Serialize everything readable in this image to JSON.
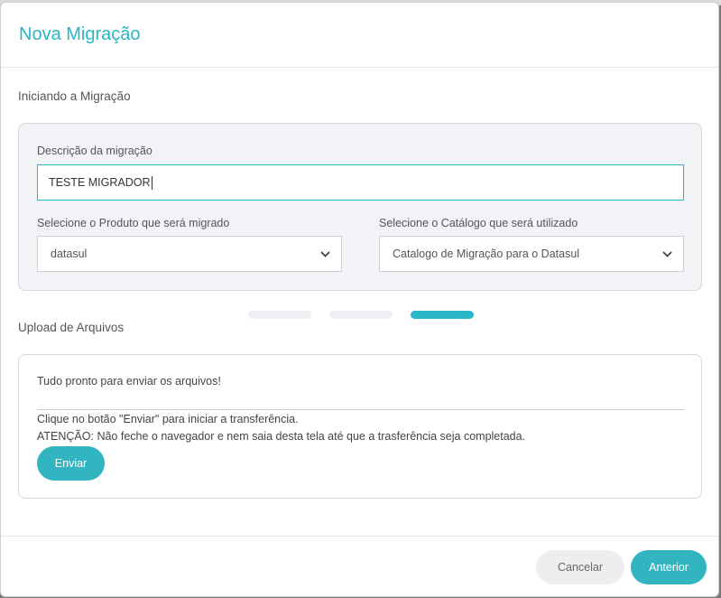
{
  "modal": {
    "title": "Nova Migração"
  },
  "start_section": {
    "label": "Iniciando a Migração",
    "description_label": "Descrição da migração",
    "description_value": "TESTE MIGRADOR",
    "product_label": "Selecione o Produto que será migrado",
    "product_value": "datasul",
    "catalog_label": "Selecione o Catálogo que será utilizado",
    "catalog_value": "Catalogo de Migração para o Datasul"
  },
  "stepper": {
    "steps": 3,
    "active_step": 3
  },
  "upload_section": {
    "label": "Upload de Arquivos",
    "ready_text": "Tudo pronto para enviar os arquivos!",
    "instruction_text": "Clique no botão \"Enviar\" para iniciar a transferência.",
    "warning_text": "ATENÇÃO: Não feche o navegador e nem saia desta tela até que a trasferência seja completada.",
    "send_label": "Enviar"
  },
  "footer": {
    "cancel_label": "Cancelar",
    "previous_label": "Anterior"
  },
  "colors": {
    "accent": "#29b6c6",
    "button_primary": "#33b5c1",
    "button_secondary": "#eeeeee"
  }
}
